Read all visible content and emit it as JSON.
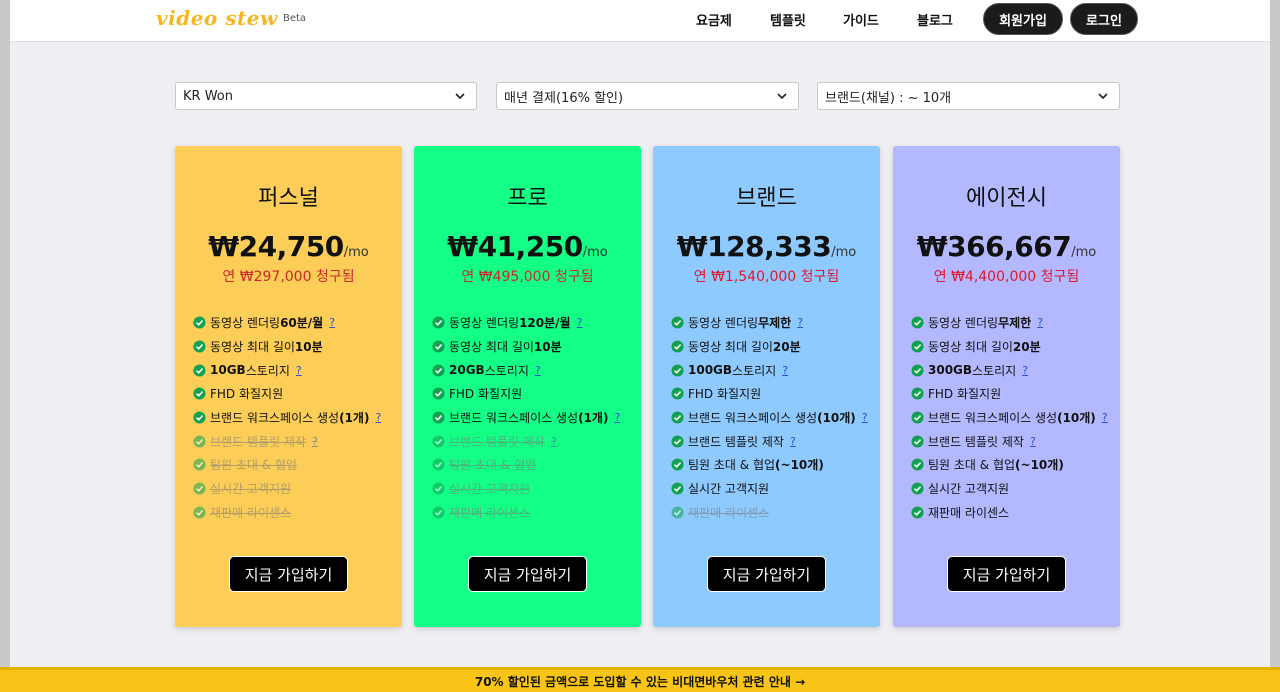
{
  "header": {
    "logo": "video stew",
    "beta": "Beta",
    "nav": [
      "요금제",
      "템플릿",
      "가이드",
      "블로그"
    ],
    "signup": "회원가입",
    "login": "로그인"
  },
  "filters": {
    "currency": "KR Won",
    "billing": "매년 결제(16% 할인)",
    "brands": "브랜드(채널) : ~ 10개"
  },
  "plans": [
    {
      "name": "퍼스널",
      "color": "#fdce57",
      "price": "₩24,750",
      "per": "/mo",
      "billed_prefix": "연 ",
      "billed_amount": "₩297,000",
      "billed_suffix": " 청구됨",
      "features": [
        {
          "pre": "동영상 렌더링 ",
          "bold": "60분/월",
          "post": "",
          "q": true,
          "on": true
        },
        {
          "pre": "동영상 최대 길이 ",
          "bold": "10분",
          "post": "",
          "q": false,
          "on": true
        },
        {
          "pre": "",
          "bold": "10GB",
          "post": " 스토리지",
          "q": true,
          "on": true
        },
        {
          "pre": "FHD 화질지원",
          "bold": "",
          "post": "",
          "q": false,
          "on": true
        },
        {
          "pre": "브랜드 워크스페이스 생성",
          "bold": "(1개)",
          "post": "",
          "q": true,
          "on": true
        },
        {
          "pre": "브랜드 템플릿 제작",
          "bold": "",
          "post": "",
          "q": true,
          "on": false
        },
        {
          "pre": "팀원 초대 & 협업",
          "bold": "",
          "post": "",
          "q": false,
          "on": false
        },
        {
          "pre": "실시간 고객지원",
          "bold": "",
          "post": "",
          "q": false,
          "on": false
        },
        {
          "pre": "재판매 라이센스",
          "bold": "",
          "post": "",
          "q": false,
          "on": false
        }
      ],
      "cta": "지금 가입하기"
    },
    {
      "name": "프로",
      "color": "#14ff86",
      "price": "₩41,250",
      "per": "/mo",
      "billed_prefix": "연 ",
      "billed_amount": "₩495,000",
      "billed_suffix": " 청구됨",
      "features": [
        {
          "pre": "동영상 렌더링 ",
          "bold": "120분/월",
          "post": "",
          "q": true,
          "on": true
        },
        {
          "pre": "동영상 최대 길이 ",
          "bold": "10분",
          "post": "",
          "q": false,
          "on": true
        },
        {
          "pre": "",
          "bold": "20GB",
          "post": " 스토리지",
          "q": true,
          "on": true
        },
        {
          "pre": "FHD 화질지원",
          "bold": "",
          "post": "",
          "q": false,
          "on": true
        },
        {
          "pre": "브랜드 워크스페이스 생성",
          "bold": "(1개)",
          "post": "",
          "q": true,
          "on": true
        },
        {
          "pre": "브랜드 템플릿 제작",
          "bold": "",
          "post": "",
          "q": true,
          "on": false
        },
        {
          "pre": "팀원 초대 & 협업",
          "bold": "",
          "post": "",
          "q": false,
          "on": false
        },
        {
          "pre": "실시간 고객지원",
          "bold": "",
          "post": "",
          "q": false,
          "on": false
        },
        {
          "pre": "재판매 라이센스",
          "bold": "",
          "post": "",
          "q": false,
          "on": false
        }
      ],
      "cta": "지금 가입하기"
    },
    {
      "name": "브랜드",
      "color": "#8fcaff",
      "price": "₩128,333",
      "per": "/mo",
      "billed_prefix": "연 ",
      "billed_amount": "₩1,540,000",
      "billed_suffix": " 청구됨",
      "features": [
        {
          "pre": "동영상 렌더링 ",
          "bold": "무제한",
          "post": "",
          "q": true,
          "on": true
        },
        {
          "pre": "동영상 최대 길이 ",
          "bold": "20분",
          "post": "",
          "q": false,
          "on": true
        },
        {
          "pre": "",
          "bold": "100GB",
          "post": " 스토리지",
          "q": true,
          "on": true
        },
        {
          "pre": "FHD 화질지원",
          "bold": "",
          "post": "",
          "q": false,
          "on": true
        },
        {
          "pre": "브랜드 워크스페이스 생성",
          "bold": "(10개)",
          "post": "",
          "q": true,
          "on": true
        },
        {
          "pre": "브랜드 템플릿 제작",
          "bold": "",
          "post": "",
          "q": true,
          "on": true
        },
        {
          "pre": "팀원 초대 & 협업",
          "bold": "(~10개)",
          "post": "",
          "q": false,
          "on": true
        },
        {
          "pre": "실시간 고객지원",
          "bold": "",
          "post": "",
          "q": false,
          "on": true
        },
        {
          "pre": "재판매 라이센스",
          "bold": "",
          "post": "",
          "q": false,
          "on": false
        }
      ],
      "cta": "지금 가입하기"
    },
    {
      "name": "에이전시",
      "color": "#b3b8ff",
      "price": "₩366,667",
      "per": "/mo",
      "billed_prefix": "연 ",
      "billed_amount": "₩4,400,000",
      "billed_suffix": " 청구됨",
      "features": [
        {
          "pre": "동영상 렌더링 ",
          "bold": "무제한",
          "post": "",
          "q": true,
          "on": true
        },
        {
          "pre": "동영상 최대 길이 ",
          "bold": "20분",
          "post": "",
          "q": false,
          "on": true
        },
        {
          "pre": "",
          "bold": "300GB",
          "post": " 스토리지",
          "q": true,
          "on": true
        },
        {
          "pre": "FHD 화질지원",
          "bold": "",
          "post": "",
          "q": false,
          "on": true
        },
        {
          "pre": "브랜드 워크스페이스 생성",
          "bold": "(10개)",
          "post": "",
          "q": true,
          "on": true
        },
        {
          "pre": "브랜드 템플릿 제작",
          "bold": "",
          "post": "",
          "q": true,
          "on": true
        },
        {
          "pre": "팀원 초대 & 협업",
          "bold": "(~10개)",
          "post": "",
          "q": false,
          "on": true
        },
        {
          "pre": "실시간 고객지원",
          "bold": "",
          "post": "",
          "q": false,
          "on": true
        },
        {
          "pre": "재판매 라이센스",
          "bold": "",
          "post": "",
          "q": false,
          "on": true
        }
      ],
      "cta": "지금 가입하기"
    }
  ],
  "question_mark": "?",
  "banner": "70% 할인된 금액으로 도입할 수 있는 비대면바우처 관련 안내 →",
  "colors": {
    "check": "#12a150",
    "billed_red": "#e0192b",
    "billed_dark_red": "#c82a2a",
    "banner": "#f8c417"
  }
}
